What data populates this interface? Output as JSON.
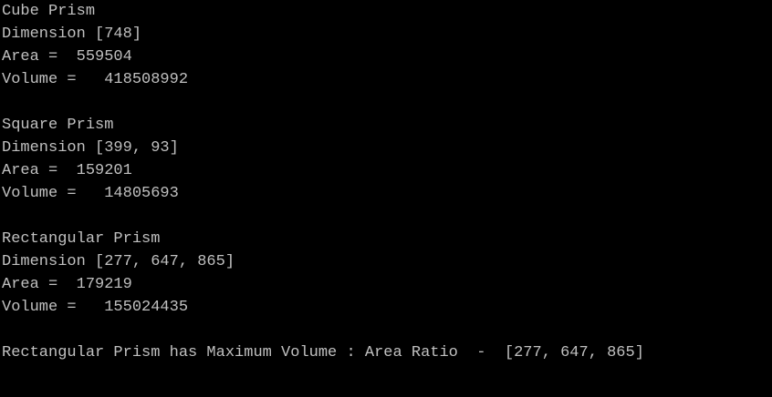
{
  "console": {
    "lines": [
      "Cube Prism",
      "Dimension [748]",
      "Area =  559504",
      "Volume =   418508992",
      "",
      "Square Prism",
      "Dimension [399, 93]",
      "Area =  159201",
      "Volume =   14805693",
      "",
      "Rectangular Prism",
      "Dimension [277, 647, 865]",
      "Area =  179219",
      "Volume =   155024435",
      "",
      "Rectangular Prism has Maximum Volume : Area Ratio  -  [277, 647, 865]"
    ]
  }
}
